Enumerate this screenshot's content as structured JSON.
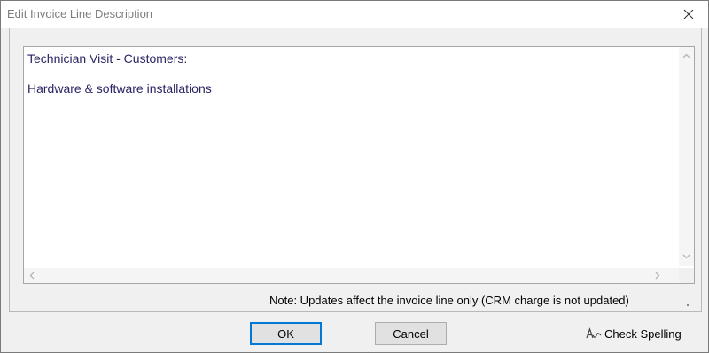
{
  "window": {
    "title": "Edit Invoice Line Description"
  },
  "editor": {
    "lines": [
      "Technician Visit - Customers:",
      "Hardware & software installations"
    ]
  },
  "note": "Note: Updates affect the invoice line only (CRM charge is not updated)",
  "buttons": {
    "ok": "OK",
    "cancel": "Cancel",
    "check_spelling": "Check Spelling"
  },
  "icons": {
    "close": "close-icon",
    "scroll_up": "chevron-up-icon",
    "scroll_down": "chevron-down-icon",
    "scroll_left": "chevron-left-icon",
    "scroll_right": "chevron-right-icon",
    "spell": "spell-check-icon"
  },
  "colors": {
    "editor_text": "#2a2564",
    "ok_border": "#0078d7"
  }
}
